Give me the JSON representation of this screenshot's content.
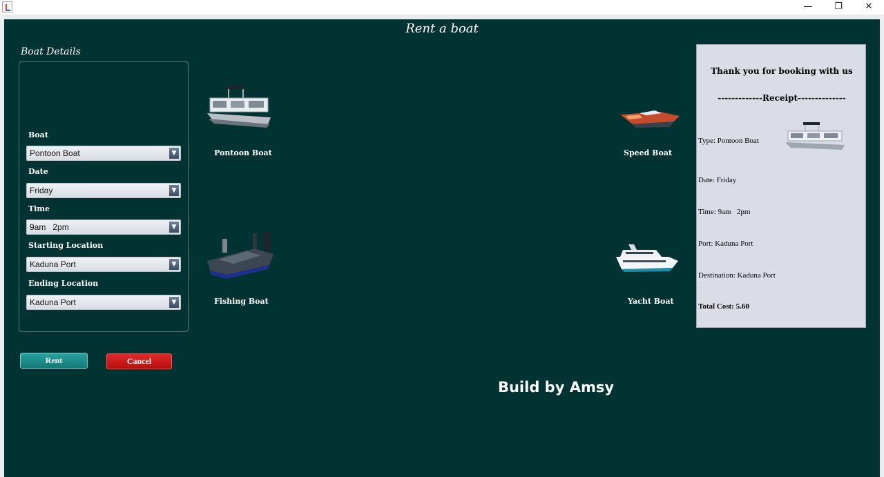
{
  "window": {
    "minimize_glyph": "—",
    "maximize_glyph": "❐",
    "close_glyph": "✕"
  },
  "app": {
    "title": "Rent a boat"
  },
  "form": {
    "section_title": "Boat Details",
    "fields": [
      {
        "label": "Boat",
        "value": "Pontoon Boat"
      },
      {
        "label": "Date",
        "value": "Friday"
      },
      {
        "label": "Time",
        "value": "9am   2pm"
      },
      {
        "label": "Starting Location",
        "value": "Kaduna Port"
      },
      {
        "label": "Ending Location",
        "value": "Kaduna Port"
      }
    ]
  },
  "buttons": {
    "rent": "Rent",
    "cancel": "Cancel"
  },
  "boats": [
    {
      "caption": "Pontoon Boat",
      "icon": "pontoon-boat-image"
    },
    {
      "caption": "Speed Boat",
      "icon": "speed-boat-image"
    },
    {
      "caption": "Fishing Boat",
      "icon": "fishing-boat-image"
    },
    {
      "caption": "Yacht Boat",
      "icon": "yacht-boat-image"
    }
  ],
  "receipt": {
    "heading": "Thank you for booking with us",
    "subheading": "-------------Receipt--------------",
    "type": "Type: Pontoon Boat",
    "date": "Date: Friday",
    "time": "Time: 9am   2pm",
    "port": "Port: Kaduna Port",
    "destination": "Destination: Kaduna Port",
    "total": "Total Cost: 5.60"
  },
  "footer": {
    "text": "Build by Amsy"
  },
  "colors": {
    "background": "#023333",
    "rent_button": "#1a8a86",
    "cancel_button": "#c81616",
    "receipt_panel": "#dadde6"
  }
}
